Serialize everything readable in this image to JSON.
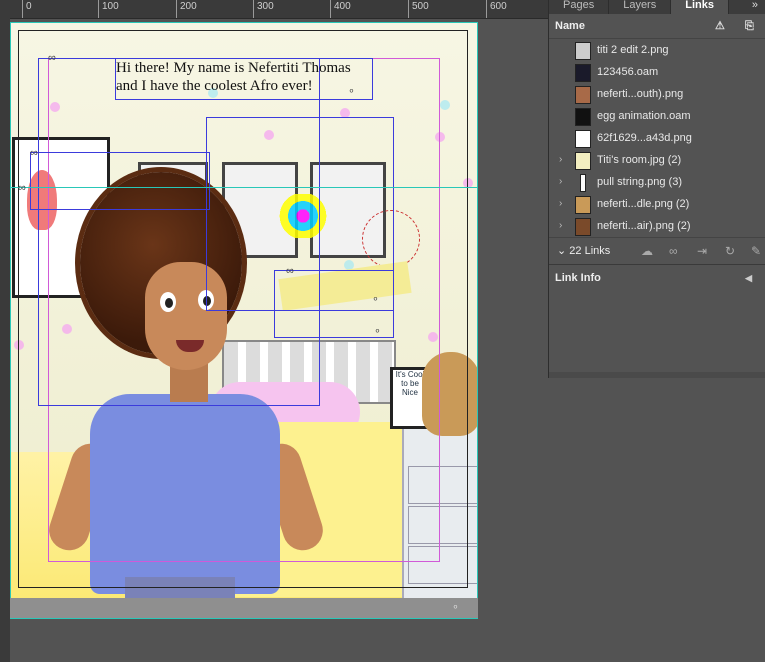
{
  "ruler": {
    "ticks": [
      "0",
      "100",
      "200",
      "300",
      "400",
      "500",
      "600"
    ]
  },
  "canvas": {
    "text_frame_text": "Hi there! My name is Nefertiti Thomas and I have the coolest Afro ever!",
    "sign_text": "It's Cool to be Nice"
  },
  "panel": {
    "tabs": [
      "Pages",
      "Layers",
      "Links"
    ],
    "more": "»",
    "column_name": "Name",
    "warn_icon": "⚠",
    "page_icon": "⎘",
    "links": [
      {
        "name": "titi 2 edit 2.png",
        "expand": ""
      },
      {
        "name": "123456.oam",
        "expand": ""
      },
      {
        "name": "neferti...outh).png",
        "expand": ""
      },
      {
        "name": "egg animation.oam",
        "expand": ""
      },
      {
        "name": "62f1629...a43d.png",
        "expand": ""
      },
      {
        "name": "Titi's room.jpg (2)",
        "expand": "›"
      },
      {
        "name": "pull string.png (3)",
        "expand": "›"
      },
      {
        "name": "neferti...dle.png (2)",
        "expand": "›"
      },
      {
        "name": "neferti...air).png (2)",
        "expand": "›"
      }
    ],
    "links_count": "22 Links",
    "links_toggle": "⌄",
    "link_info": "Link Info",
    "link_info_arrow": "◀"
  }
}
